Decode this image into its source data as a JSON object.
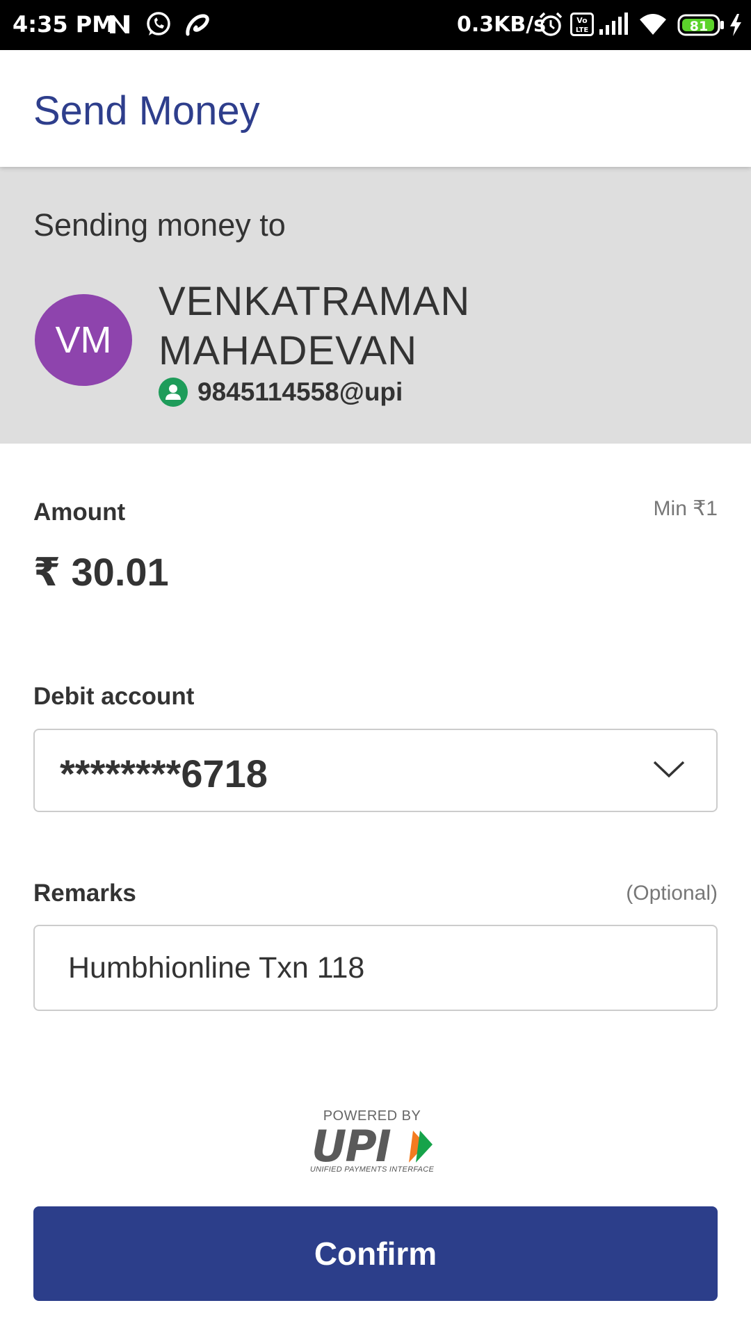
{
  "status_bar": {
    "time": "4:35 PM",
    "network_speed": "0.3KB/s",
    "battery_level": "81",
    "icons": [
      "n-notification-icon",
      "whatsapp-icon",
      "airtel-icon",
      "alarm-icon",
      "volte-icon",
      "signal-icon",
      "wifi-icon",
      "battery-icon",
      "charging-icon"
    ]
  },
  "header": {
    "title": "Send Money"
  },
  "recipient": {
    "label": "Sending money to",
    "initials": "VM",
    "name": "VENKATRAMAN MAHADEVAN",
    "vpa": "9845114558@upi",
    "avatar_color": "#8e44ad",
    "verified_color": "#1e9c5a"
  },
  "amount": {
    "label": "Amount",
    "min_hint": "Min ₹1",
    "value": "₹ 30.01"
  },
  "debit_account": {
    "label": "Debit account",
    "selected": "********6718"
  },
  "remarks": {
    "label": "Remarks",
    "optional_hint": "(Optional)",
    "value": "Humbhionline Txn 118"
  },
  "upi_logo": {
    "powered_by": "POWERED BY",
    "wordmark": "UPI",
    "tagline": "UNIFIED PAYMENTS INTERFACE"
  },
  "confirm_button": {
    "label": "Confirm",
    "color": "#2c3e8a"
  },
  "theme": {
    "primary": "#2e3e8c",
    "section_bg": "#dedede"
  }
}
